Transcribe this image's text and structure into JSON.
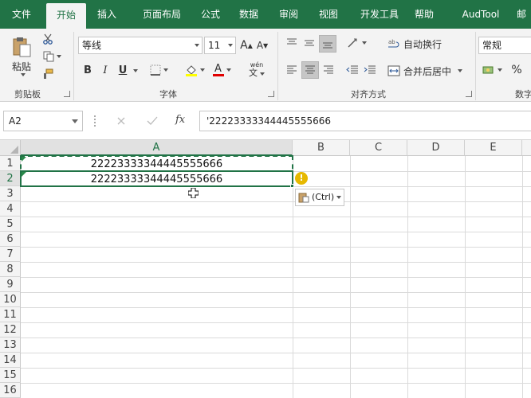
{
  "tabs": [
    {
      "label": "文件"
    },
    {
      "label": "开始"
    },
    {
      "label": "插入"
    },
    {
      "label": "页面布局"
    },
    {
      "label": "公式"
    },
    {
      "label": "数据"
    },
    {
      "label": "审阅"
    },
    {
      "label": "视图"
    },
    {
      "label": "开发工具"
    },
    {
      "label": "帮助"
    },
    {
      "label": "AudTool"
    },
    {
      "label": "邮"
    }
  ],
  "active_tab": "开始",
  "ribbon": {
    "clipboard": {
      "paste_label": "粘贴",
      "group_label": "剪贴板"
    },
    "font": {
      "font_name": "等线",
      "font_size": "11",
      "grow_label": "A",
      "shrink_label": "A",
      "bold": "B",
      "italic": "I",
      "underline": "U",
      "font_color_letter": "A",
      "phonetic_label": "wén",
      "phonetic_char": "文",
      "group_label": "字体"
    },
    "alignment": {
      "wrap_label": "自动换行",
      "merge_label": "合并后居中",
      "group_label": "对齐方式"
    },
    "number": {
      "format": "常规",
      "percent": "%",
      "group_label": "数字"
    }
  },
  "formula_bar": {
    "name_box": "A2",
    "fx_label": "fx",
    "content": "'22223333344445555666"
  },
  "columns": [
    "A",
    "B",
    "C",
    "D",
    "E"
  ],
  "rows": [
    "1",
    "2",
    "3",
    "4",
    "5",
    "6",
    "7",
    "8",
    "9",
    "10",
    "11",
    "12",
    "13",
    "14",
    "15",
    "16"
  ],
  "cells": {
    "A1": "22223333344445555666",
    "A2": "22223333344445555666"
  },
  "paste_options": {
    "label": "(Ctrl)"
  },
  "warning_symbol": "!",
  "colors": {
    "accent": "#217346",
    "selection_border": "#217346"
  }
}
